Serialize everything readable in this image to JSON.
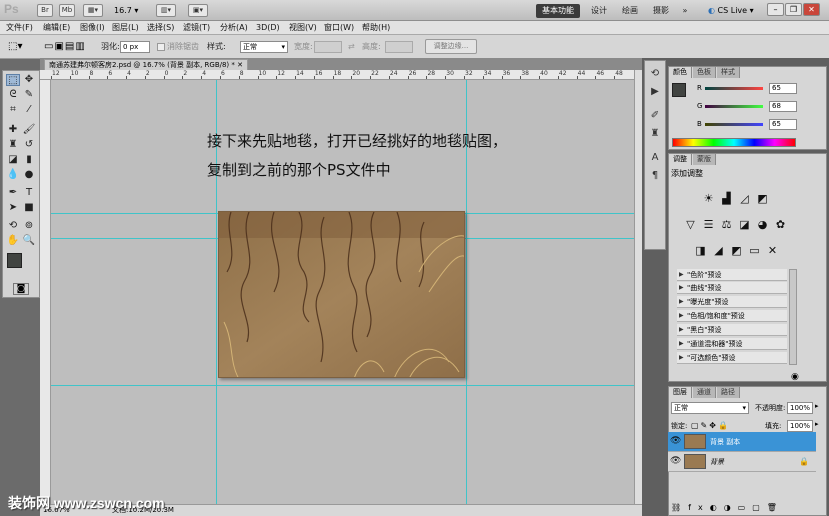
{
  "titlebar": {
    "app_logo": "Ps",
    "zoom_value": "16.7",
    "workspaces": [
      "基本功能",
      "设计",
      "绘画",
      "摄影"
    ],
    "more": "»",
    "cs_live": "CS Live",
    "icons": [
      "br-icon",
      "mb-icon",
      "guide-icon",
      "zoom-dropdown",
      "arrange-icon",
      "screen-mode-icon"
    ]
  },
  "menu": [
    "文件(F)",
    "编辑(E)",
    "图像(I)",
    "图层(L)",
    "选择(S)",
    "滤镜(T)",
    "分析(A)",
    "3D(D)",
    "视图(V)",
    "窗口(W)",
    "帮助(H)"
  ],
  "options": {
    "feather_label": "羽化:",
    "feather_value": "0 px",
    "antialias_label": "消除锯齿",
    "style_label": "样式:",
    "style_value": "正常",
    "width_label": "宽度:",
    "height_label": "高度:",
    "refine_button": "调整边缘..."
  },
  "document": {
    "tab_title": "南通苏建弗尔顿客房2.psd @ 16.7% (背景 副本, RGB/8) *",
    "ruler_ticks": [
      "12",
      "10",
      "8",
      "6",
      "4",
      "2",
      "0",
      "2",
      "4",
      "6",
      "8",
      "10",
      "12",
      "14",
      "16",
      "18",
      "20",
      "22",
      "24",
      "26",
      "28",
      "30",
      "32",
      "34",
      "36",
      "38",
      "40",
      "42",
      "44",
      "46",
      "48"
    ],
    "annotation_lines": [
      "接下来先贴地毯，打开已经挑好的地毯贴图，",
      "复制到之前的那个PS文件中"
    ],
    "status_zoom": "16.67%",
    "status_doc": "文档:10.2M/20.3M"
  },
  "color_panel": {
    "tabs": [
      "颜色",
      "色板",
      "样式"
    ],
    "channels": [
      {
        "label": "R",
        "value": "65"
      },
      {
        "label": "G",
        "value": "68"
      },
      {
        "label": "B",
        "value": "65"
      }
    ]
  },
  "adjust_panel": {
    "tabs": [
      "调整",
      "蒙版"
    ],
    "title": "添加调整",
    "presets": [
      "\"色阶\"预设",
      "\"曲线\"预设",
      "\"曝光度\"预设",
      "\"色相/饱和度\"预设",
      "\"黑白\"预设",
      "\"通道混和器\"预设",
      "\"可选颜色\"预设"
    ]
  },
  "layers_panel": {
    "tabs": [
      "图层",
      "通道",
      "路径"
    ],
    "blend_mode": "正常",
    "opacity_label": "不透明度:",
    "opacity_value": "100%",
    "lock_label": "锁定:",
    "fill_label": "填充:",
    "fill_value": "100%",
    "layers": [
      {
        "name": "背景 副本",
        "selected": true
      },
      {
        "name": "背景",
        "selected": false
      }
    ]
  },
  "watermark": "装饰网 www.zswcn.com",
  "colors": {
    "guide": "#40c4c9",
    "selected_layer": "#3a93d6",
    "carpet": "#9a7a52"
  }
}
